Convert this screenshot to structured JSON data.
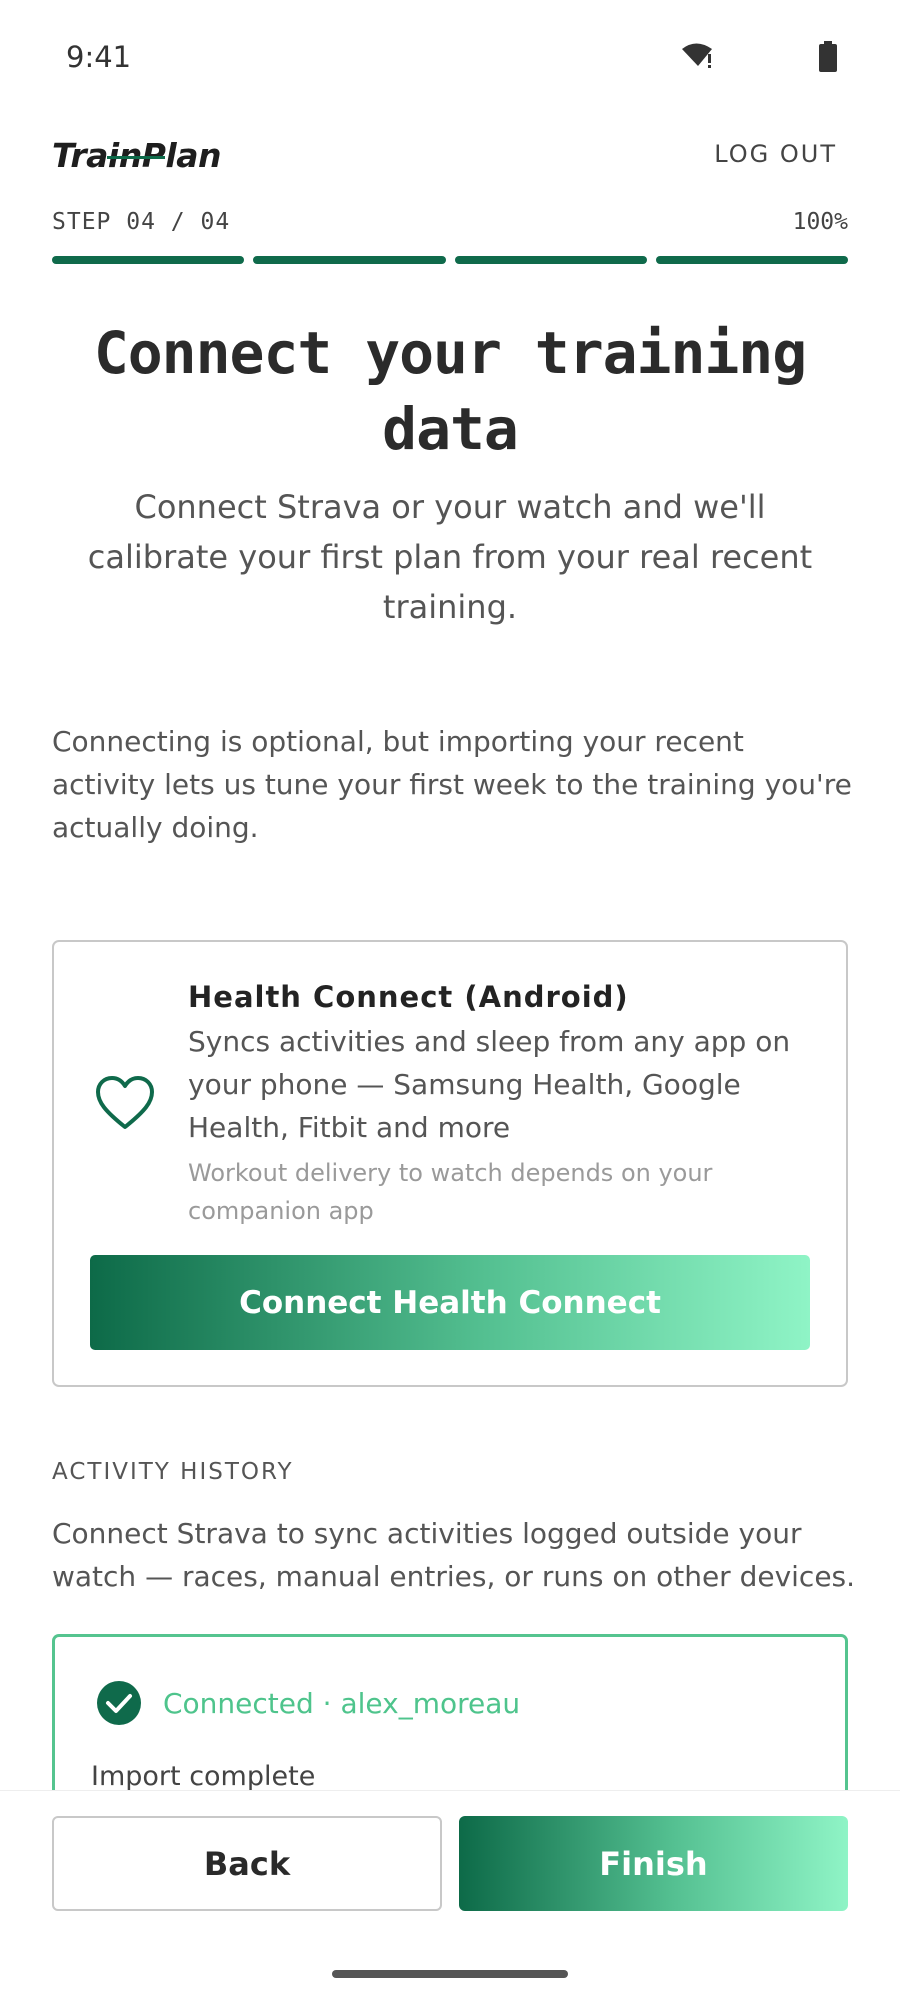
{
  "status_bar": {
    "time": "9:41",
    "icons": [
      "wifi-icon",
      "battery-icon"
    ]
  },
  "header": {
    "brand": "TrainPlan",
    "logout_label": "LOG OUT"
  },
  "progress": {
    "step_label": "STEP 04 / 04",
    "percent_label": "100%",
    "completed_steps": 4,
    "total_steps": 4
  },
  "main": {
    "title": "Connect your training data",
    "subtitle": "Connect Strava or your watch and we'll calibrate your first plan from your real recent training.",
    "intro": "Connecting is optional, but importing your recent activity lets us tune your first week to the training you're actually doing."
  },
  "health_connect": {
    "icon": "heart-icon",
    "title": "Health Connect (Android)",
    "description": "Syncs activities and sleep from any app on your phone — Samsung Health, Google Health, Fitbit and more",
    "note": "Workout delivery to watch depends on your companion app",
    "button_label": "Connect Health Connect"
  },
  "activity_history": {
    "section_label": "ACTIVITY HISTORY",
    "description": "Connect Strava to sync activities logged outside your watch — races, manual entries, or runs on other devices.",
    "strava": {
      "icon": "check-circle-icon",
      "status": "Connected · alex_moreau",
      "import_status": "Import complete"
    }
  },
  "footer": {
    "back_label": "Back",
    "finish_label": "Finish"
  },
  "colors": {
    "accent": "#0f6a4b",
    "accent_light": "#8ff4c6",
    "connected": "#4ec48c"
  }
}
